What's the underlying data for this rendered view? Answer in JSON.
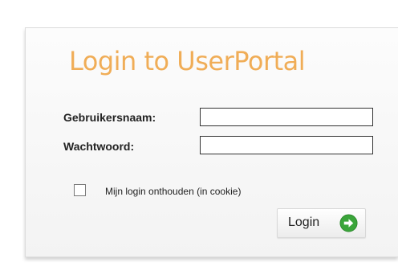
{
  "login": {
    "title": "Login to UserPortal",
    "username_label": "Gebruikersnaam:",
    "username_value": "",
    "password_label": "Wachtwoord:",
    "password_value": "",
    "remember_label": "Mijn login onthouden (in cookie)",
    "remember_checked": false,
    "submit_label": "Login",
    "submit_icon": "arrow-right-circle-icon"
  },
  "colors": {
    "title": "#f0ad57",
    "accent_green": "#3aa53a"
  }
}
